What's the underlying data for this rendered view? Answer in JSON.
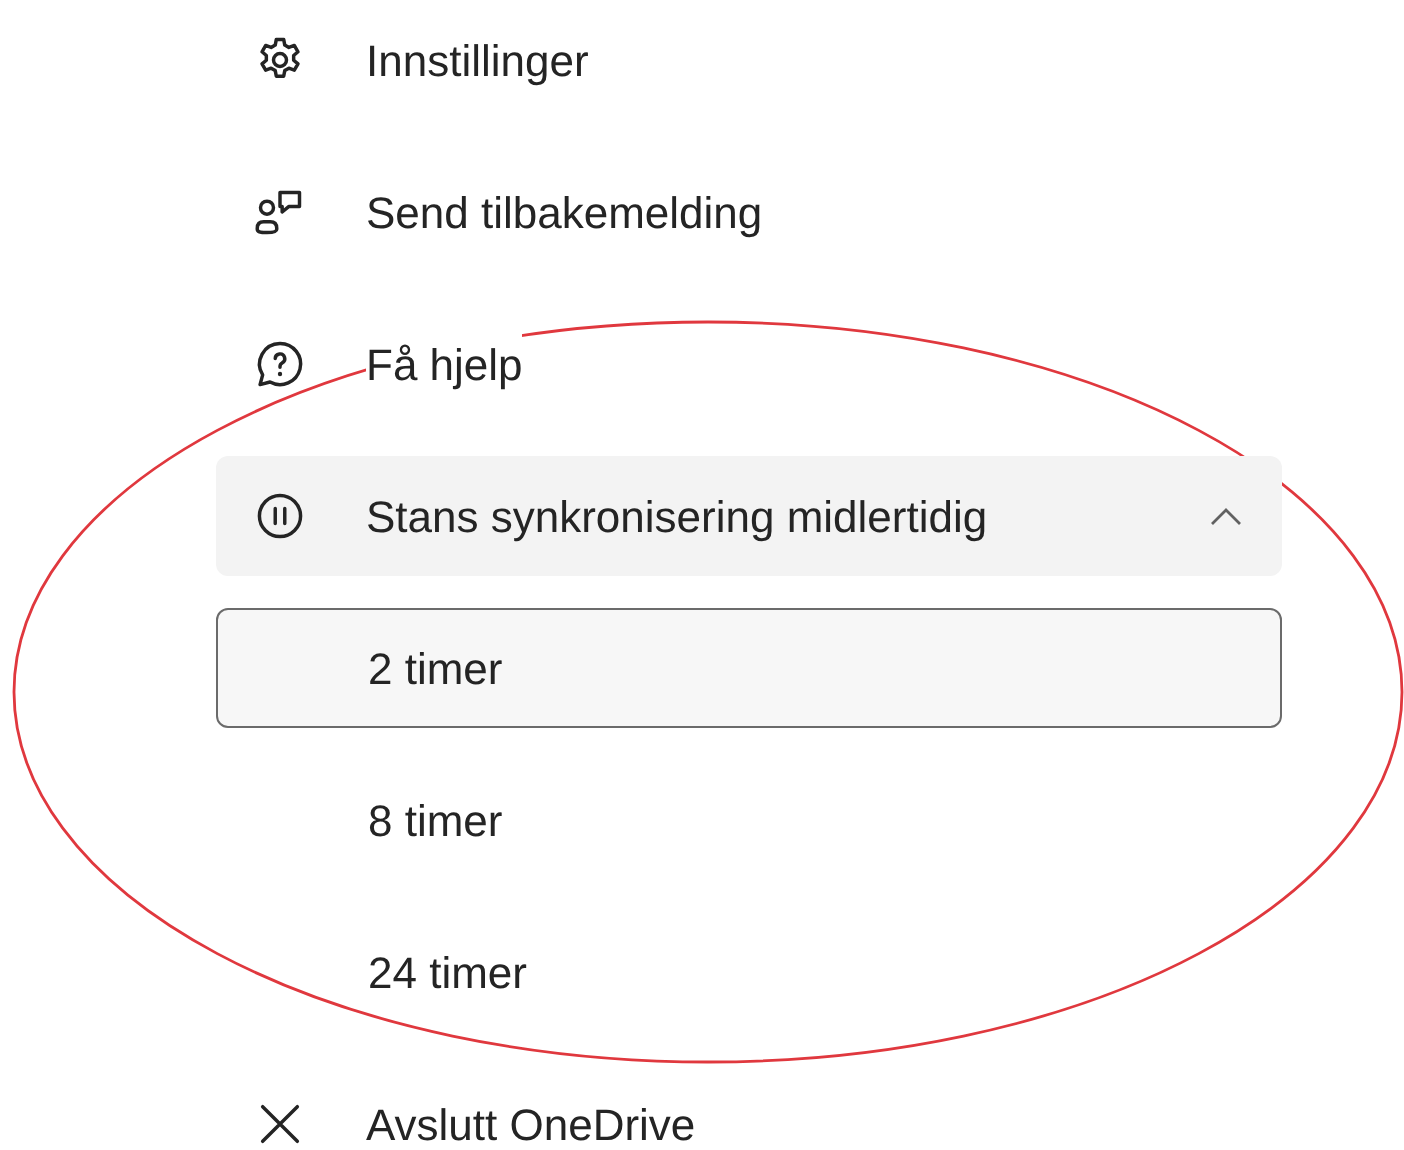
{
  "menu": {
    "items": [
      {
        "kind": "item",
        "label": "Innstillinger"
      },
      {
        "kind": "item",
        "label": "Send tilbakemelding"
      },
      {
        "kind": "item",
        "label": "Få hjelp"
      },
      {
        "kind": "expandable",
        "label": "Stans synkronisering midlertidig",
        "expanded": true,
        "children": [
          {
            "label": "2 timer",
            "selected": true
          },
          {
            "label": "8 timer",
            "selected": false
          },
          {
            "label": "24 timer",
            "selected": false
          }
        ]
      },
      {
        "kind": "item",
        "label": "Avslutt OneDrive"
      }
    ]
  }
}
